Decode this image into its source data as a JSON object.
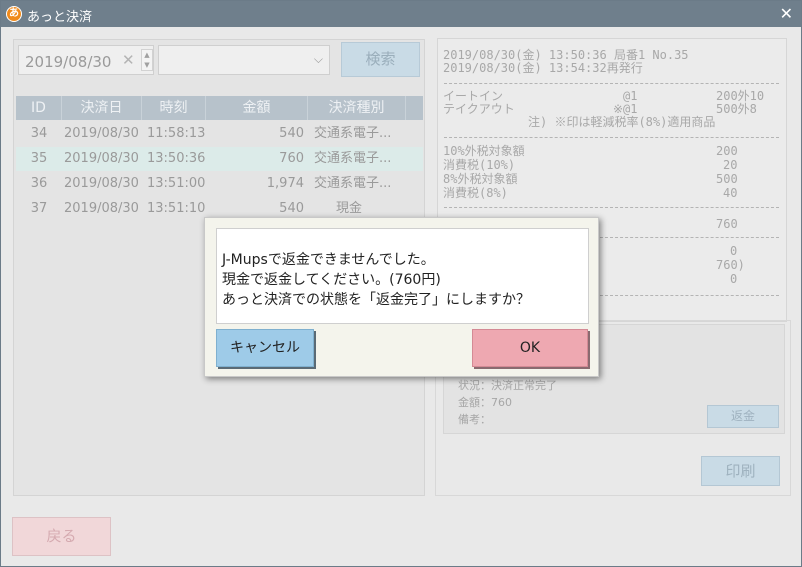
{
  "window": {
    "title": "あっと決済",
    "close_glyph": "✕",
    "app_icon_glyph": "あ"
  },
  "filter": {
    "date_value": "2019/08/30",
    "clear_glyph": "✕",
    "select_value": "",
    "search_label": "検索"
  },
  "table": {
    "headers": [
      "ID",
      "決済日",
      "時刻",
      "金額",
      "決済種別"
    ],
    "rows": [
      {
        "id": "34",
        "date": "2019/08/30",
        "time": "11:58:13",
        "amount": "540",
        "type": "交通系電子..."
      },
      {
        "id": "35",
        "date": "2019/08/30",
        "time": "13:50:36",
        "amount": "760",
        "type": "交通系電子..."
      },
      {
        "id": "36",
        "date": "2019/08/30",
        "time": "13:51:00",
        "amount": "1,974",
        "type": "交通系電子..."
      },
      {
        "id": "37",
        "date": "2019/08/30",
        "time": "13:51:10",
        "amount": "540",
        "type": "現金"
      }
    ],
    "selected_index": 1
  },
  "receipt": {
    "line1": "2019/08/30(金) 13:50:36 局番1 No.35",
    "line2": "2019/08/30(金) 13:54:32再発行",
    "item1_name": "イートイン",
    "item1_qty": "@1",
    "item1_amount": "200外10",
    "item2_name": "テイクアウト",
    "item2_qty": "※@1",
    "item2_amount": "500外8",
    "note": "注) ※印は軽減税率(8%)適用商品",
    "tax10_label": "10%外税対象額",
    "tax10_value": "200",
    "tax10_vat_label": "消費税(10%)",
    "tax10_vat_value": "20",
    "tax8_label": "8%外税対象額",
    "tax8_value": "500",
    "tax8_vat_label": "消費税(8%)",
    "tax8_vat_value": "40",
    "total_value": "760",
    "pay1": "0",
    "pay2": "760)",
    "pay3": "0"
  },
  "detail": {
    "status": "状況：決済正常完了",
    "amount": "金額：760",
    "remarks": "備考：",
    "refund_label": "返金"
  },
  "print_label": "印刷",
  "back_label": "戻る",
  "dialog": {
    "line1": "J-Mupsで返金できませんでした。",
    "line2": "現金で返金してください。(760円)",
    "line3": "あっと決済での状態を「返金完了」にしますか？",
    "cancel_label": "キャンセル",
    "ok_label": "OK"
  }
}
